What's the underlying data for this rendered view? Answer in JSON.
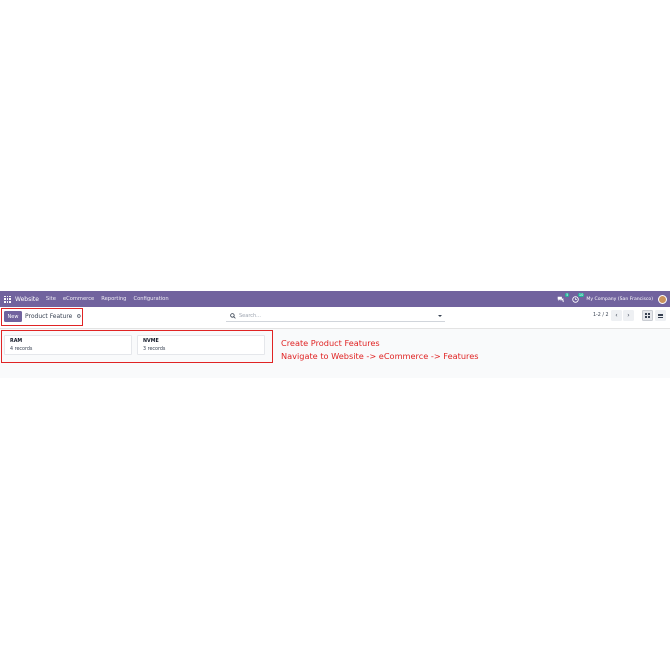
{
  "navbar": {
    "brand": "Website",
    "menu": [
      "Site",
      "eCommerce",
      "Reporting",
      "Configuration"
    ],
    "messages_count": "5",
    "activities_count": "10",
    "company": "My Company (San Francisco)"
  },
  "control_panel": {
    "new_label": "New",
    "breadcrumb": "Product Feature",
    "search_placeholder": "Search...",
    "pager": "1-2 / 2"
  },
  "cards": [
    {
      "title": "RAM",
      "count": "4 records"
    },
    {
      "title": "NVME",
      "count": "3 records"
    }
  ],
  "annotations": {
    "line1": "Create Product Features",
    "line2": "Navigate to Website -> eCommerce -> Features"
  },
  "colors": {
    "brand": "#71639e",
    "annotation": "#e02424",
    "badge": "#21b799"
  },
  "icons": [
    "apps-grid-icon",
    "chat-icon",
    "clock-icon",
    "gear-icon",
    "search-icon",
    "caret-down-icon",
    "chevron-left-icon",
    "chevron-right-icon",
    "kanban-view-icon",
    "list-view-icon"
  ]
}
